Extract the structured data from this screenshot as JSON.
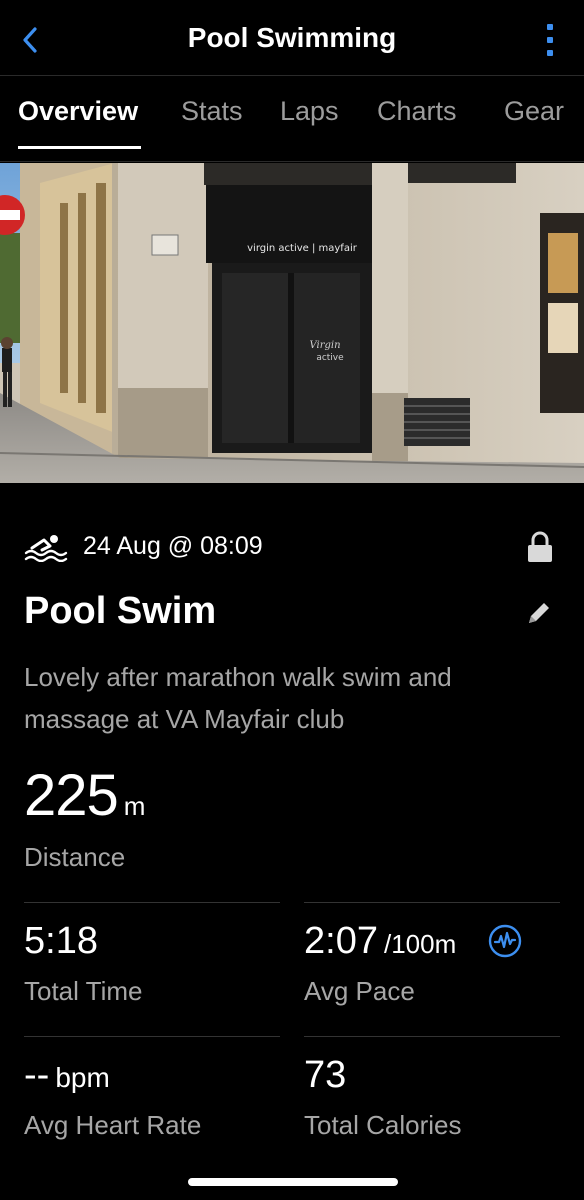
{
  "header": {
    "title": "Pool Swimming",
    "back_icon": "chevron-left-icon",
    "more_icon": "more-vertical-icon",
    "accent_color": "#3d8ff0"
  },
  "tabs": [
    {
      "label": "Overview",
      "active": true
    },
    {
      "label": "Stats",
      "active": false
    },
    {
      "label": "Laps",
      "active": false
    },
    {
      "label": "Charts",
      "active": false
    },
    {
      "label": "Gear",
      "active": false
    }
  ],
  "photo": {
    "awning_text": "virgin active | mayfair",
    "door_text": "Virgin active"
  },
  "activity": {
    "date": "24 Aug @ 08:09",
    "title": "Pool Swim",
    "description": "Lovely after marathon walk swim and massage at VA Mayfair club",
    "activity_icon": "swimming-icon",
    "privacy_icon": "lock-icon",
    "edit_icon": "pencil-icon"
  },
  "distance": {
    "value": "225",
    "unit": "m",
    "label": "Distance"
  },
  "stats": {
    "total_time": {
      "value": "5:18",
      "label": "Total Time"
    },
    "avg_pace": {
      "value": "2:07",
      "unit": "/100m",
      "label": "Avg Pace",
      "icon": "heart-rate-pulse-icon"
    },
    "avg_heart_rate": {
      "value": "--",
      "unit": "bpm",
      "label": "Avg Heart Rate"
    },
    "total_calories": {
      "value": "73",
      "label": "Total Calories"
    }
  }
}
